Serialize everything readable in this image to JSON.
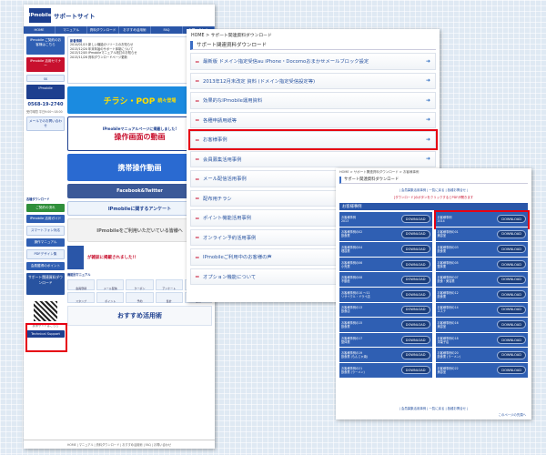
{
  "panel_a": {
    "logo_text": "IPmobile",
    "site_title": "サポートサイト",
    "nav": [
      "HOME",
      "マニュアル",
      "資料ダウンロード",
      "おすすめ活用術",
      "FAQ",
      "お問い合わせ"
    ],
    "news_title": "新着情報",
    "news": [
      "2014/01/15 新しい機能のリリースのお知らせ",
      "2013/12/20 年末年始のサポート体制について",
      "2013/12/05 IPmobileマニュアル改訂のお知らせ",
      "2013/11/28 資料ダウンロードページ更新"
    ],
    "sidebar": {
      "top_btn1": "IPmobile ご契約のお客様はこちら",
      "top_btn2": "IPmobile 活用セミナー",
      "phone": "0568-19-2740",
      "phone_sub": "受付時間 平日9:00〜18:00",
      "mail_btn": "メールでのお問い合わせ",
      "download_heading": "各種ダウンロード",
      "dl1": "ご契約の流れ",
      "dl2": "IPmobile 活用ガイド",
      "dl3": "スマートフォン対応",
      "dl4": "操作マニュアル",
      "dl5": "PDFデザイン集",
      "dl6": "会員獲得のポイント",
      "target_btn": "サポート関連資料ダウンロード",
      "qr_label": "携帯サイトはこちら",
      "tech": "Technical Support"
    },
    "banners": {
      "pop": "チラシ・POP",
      "pop_sub": "続々登場",
      "manual": "操作画面の動画",
      "manual_sub": "IPmobileマニュアルページに掲載しました!",
      "video": "携帯操作動画",
      "fb": "Facebook&Twitter",
      "survey": "IPmobileに関するアンケート",
      "gray": "IPmobileをご利用いただいている皆様へ"
    },
    "magazine_text": "が雑誌に掲載されました!!",
    "manual_heading": "機能別マニュアル",
    "manual_icons": [
      "会員登録",
      "メール配信",
      "クーポン",
      "アンケート",
      "抽選",
      "スタンプ",
      "ポイント",
      "予約",
      "集計",
      "設定"
    ],
    "case_banner": "おすすめ活用術",
    "footer": "HOME | マニュアル | 資料ダウンロード | おすすめ活用術 | FAQ | お問い合わせ"
  },
  "panel_b": {
    "crumb": "HOME > サポート関連資料ダウンロード",
    "title": "サポート関連資料ダウンロード",
    "items": [
      {
        "label": "最新版 ドメイン指定受信au iPhone・Docomoおまかせメールブロック設定",
        "hl": false
      },
      {
        "label": "2013年12月末改定 資料 (ドメイン指定受信設定等)",
        "hl": false
      },
      {
        "label": "効果的なIPmobile運用資料",
        "hl": false
      },
      {
        "label": "各種申請用紙等",
        "hl": false
      },
      {
        "label": "お客様事例",
        "hl": true
      },
      {
        "label": "会員募集活用事例",
        "hl": false
      },
      {
        "label": "メール配信活用事例",
        "hl": false
      },
      {
        "label": "配布用チラシ",
        "hl": false
      },
      {
        "label": "ポイント機能活用事例",
        "hl": false
      },
      {
        "label": "オンライン予約活用事例",
        "hl": false
      },
      {
        "label": "IPmobileご利用中のお客様の声",
        "hl": false
      },
      {
        "label": "オプション機能について",
        "hl": false
      }
    ]
  },
  "panel_c": {
    "crumb": "HOME > サポート関連資料ダウンロード > お客様事例",
    "title": "サポート関連資料ダウンロード",
    "links": "| 会員募集活用事例 | 一覧に戻る | 各種お問合せ |",
    "note": "[ダウンロード]のボタンをクリックするとPDFが開きます",
    "section": "お客様事例",
    "download_label": "DOWNLOAD",
    "left_rows": [
      "お客様事例\n2013",
      "お客様事例の02\n飲食業",
      "お客様事例の04\n理容業",
      "お客様事例の06\n小売業",
      "お客様事例の08\n不動産",
      "お客様事例の10 〜11\nリサイクル・ドライ店",
      "お客様事例の13\n飲食店",
      "お客様事例の15\n飲食業",
      "お客様事例の17\n整体業",
      "お客様事例の19\n飲食業 (もんじゃ焼)",
      "お客様事例の21\n飲食業 (ラーメン)"
    ],
    "right_rows": [
      {
        "label": "お客様事例\n2014",
        "hl": true
      },
      {
        "label": "お客様事例の01\n美容室",
        "hl": false
      },
      {
        "label": "お客様事例の03\n飲食業",
        "hl": false
      },
      {
        "label": "お客様事例の05\n整体業",
        "hl": false
      },
      {
        "label": "お客様事例の07\n飲食・美容業",
        "hl": false
      },
      {
        "label": "お客様事例の12\n飲食業",
        "hl": false
      },
      {
        "label": "お客様事例の14\nエステ",
        "hl": false
      },
      {
        "label": "お客様事例の16\n美容室",
        "hl": false
      },
      {
        "label": "お客様事例の18\n洋菓子店",
        "hl": false
      },
      {
        "label": "お客様事例の20\n飲食業 (ラーメン)",
        "hl": false
      },
      {
        "label": "お客様事例の22\n美容室",
        "hl": false
      }
    ],
    "bottom_links": "| 会員募集活用事例 | 一覧に戻る | 各種お問合せ |",
    "pager": "このページの先頭へ"
  },
  "colors": {
    "accent": "#2a56a8",
    "highlight": "#e60012"
  }
}
